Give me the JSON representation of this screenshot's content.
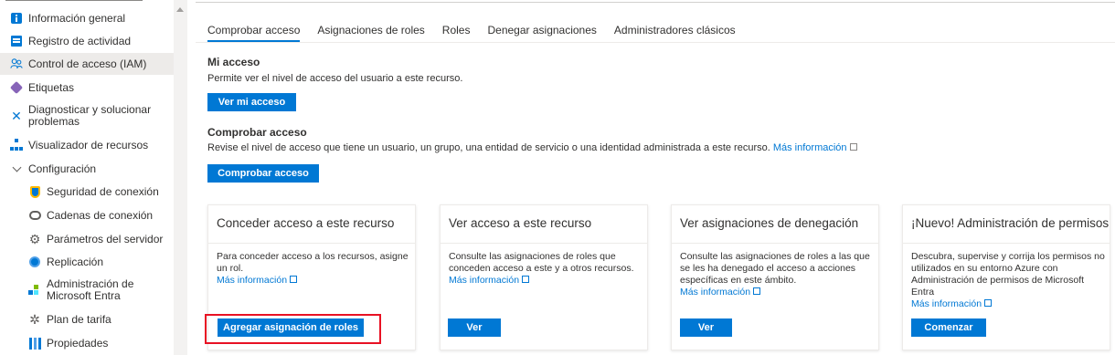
{
  "sidebar": {
    "items": [
      {
        "label": "Información general",
        "icon": "info-icon"
      },
      {
        "label": "Registro de actividad",
        "icon": "activity-log-icon"
      },
      {
        "label": "Control de acceso (IAM)",
        "icon": "iam-people-icon",
        "selected": true
      },
      {
        "label": "Etiquetas",
        "icon": "tag-icon"
      },
      {
        "label": "Diagnosticar y solucionar problemas",
        "icon": "wrench-icon"
      },
      {
        "label": "Visualizador de recursos",
        "icon": "resource-tree-icon"
      },
      {
        "label": "Configuración",
        "icon": "chevron-down-icon",
        "expanded": true
      },
      {
        "label": "Seguridad de conexión",
        "icon": "shield-icon"
      },
      {
        "label": "Cadenas de conexión",
        "icon": "connection-chain-icon"
      },
      {
        "label": "Parámetros del servidor",
        "icon": "gear-icon"
      },
      {
        "label": "Replicación",
        "icon": "globe-icon"
      },
      {
        "label": "Administración de Microsoft Entra",
        "icon": "entra-icon"
      },
      {
        "label": "Plan de tarifa",
        "icon": "pricing-gear-icon"
      },
      {
        "label": "Propiedades",
        "icon": "properties-icon"
      }
    ]
  },
  "tabs": [
    {
      "label": "Comprobar acceso",
      "active": true
    },
    {
      "label": "Asignaciones de roles"
    },
    {
      "label": "Roles"
    },
    {
      "label": "Denegar asignaciones"
    },
    {
      "label": "Administradores clásicos"
    }
  ],
  "my_access": {
    "title": "Mi acceso",
    "description": "Permite ver el nivel de acceso del usuario a este recurso.",
    "button": "Ver mi acceso"
  },
  "check_access": {
    "title": "Comprobar acceso",
    "description": "Revise el nivel de acceso que tiene un usuario, un grupo, una entidad de servicio o una identidad administrada a este recurso.",
    "link": "Más información",
    "button": "Comprobar acceso"
  },
  "cards": [
    {
      "title": "Conceder acceso a este recurso",
      "description": "Para conceder acceso a los recursos, asigne un rol.",
      "link": "Más información",
      "button": "Agregar asignación de roles"
    },
    {
      "title": "Ver acceso a este recurso",
      "description": "Consulte las asignaciones de roles que conceden acceso a este y a otros recursos.",
      "link": "Más información",
      "button": "Ver"
    },
    {
      "title": "Ver asignaciones de denegación",
      "description": "Consulte las asignaciones de roles a las que se les ha denegado el acceso a acciones específicas en este ámbito.",
      "link": "Más información",
      "button": "Ver"
    },
    {
      "title": "¡Nuevo! Administración de permisos",
      "description": "Descubra, supervise y corrija los permisos no utilizados en su entorno Azure con Administración de permisos de Microsoft Entra",
      "link": "Más información",
      "button": "Comenzar"
    }
  ],
  "colors": {
    "accent": "#0078d4",
    "highlight": "#e81123",
    "selected_bg": "#edebe9"
  }
}
